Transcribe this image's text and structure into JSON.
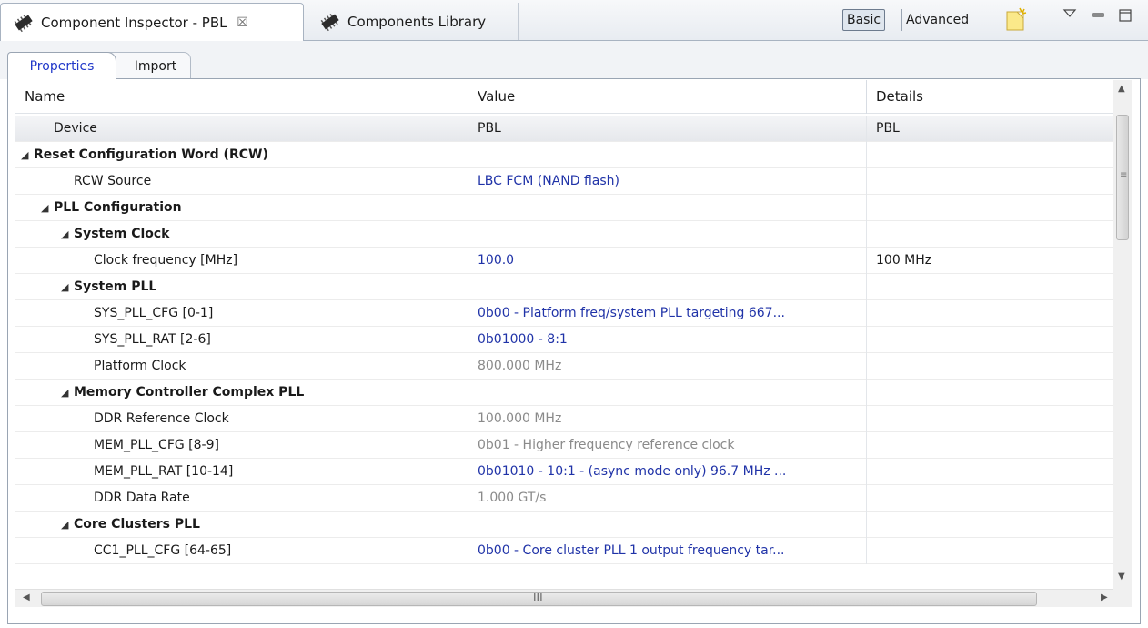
{
  "view_tabs": [
    {
      "label": "Component Inspector - PBL",
      "icon": "component-icon",
      "close": "☒"
    },
    {
      "label": "Components Library",
      "icon": "component-icon"
    }
  ],
  "toolbar": {
    "basic_label": "Basic",
    "advanced_label": "Advanced"
  },
  "sub_tabs": [
    "Properties",
    "Import"
  ],
  "table": {
    "columns": [
      "Name",
      "Value",
      "Details"
    ],
    "rows": [
      {
        "name": "Device",
        "value": "PBL",
        "details": "PBL",
        "indent": 1,
        "expander": false,
        "bold": false,
        "style": "normal"
      },
      {
        "name": "Reset Configuration Word (RCW)",
        "value": "",
        "details": "",
        "indent": 0,
        "expander": true,
        "bold": true,
        "style": "normal"
      },
      {
        "name": "RCW Source",
        "value": "LBC FCM (NAND flash)",
        "details": "",
        "indent": 2,
        "expander": false,
        "bold": false,
        "style": "blue"
      },
      {
        "name": "PLL Configuration",
        "value": "",
        "details": "",
        "indent": 1,
        "expander": true,
        "bold": true,
        "style": "normal"
      },
      {
        "name": "System Clock",
        "value": "",
        "details": "",
        "indent": 2,
        "expander": true,
        "bold": true,
        "style": "normal"
      },
      {
        "name": "Clock frequency [MHz]",
        "value": "100.0",
        "details": "100 MHz",
        "indent": 3,
        "expander": false,
        "bold": false,
        "style": "blue"
      },
      {
        "name": "System PLL",
        "value": "",
        "details": "",
        "indent": 2,
        "expander": true,
        "bold": true,
        "style": "normal"
      },
      {
        "name": "SYS_PLL_CFG  [0-1]",
        "value": "0b00 - Platform freq/system PLL targeting 667...",
        "details": "",
        "indent": 3,
        "expander": false,
        "bold": false,
        "style": "blue"
      },
      {
        "name": "SYS_PLL_RAT  [2-6]",
        "value": "0b01000 - 8:1",
        "details": "",
        "indent": 3,
        "expander": false,
        "bold": false,
        "style": "blue"
      },
      {
        "name": "Platform Clock",
        "value": "800.000 MHz",
        "details": "",
        "indent": 3,
        "expander": false,
        "bold": false,
        "style": "gray"
      },
      {
        "name": "Memory Controller Complex PLL",
        "value": "",
        "details": "",
        "indent": 2,
        "expander": true,
        "bold": true,
        "style": "normal"
      },
      {
        "name": "DDR Reference Clock",
        "value": "100.000 MHz",
        "details": "",
        "indent": 3,
        "expander": false,
        "bold": false,
        "style": "gray"
      },
      {
        "name": "MEM_PLL_CFG  [8-9]",
        "value": "0b01 - Higher frequency reference clock",
        "details": "",
        "indent": 3,
        "expander": false,
        "bold": false,
        "style": "gray"
      },
      {
        "name": "MEM_PLL_RAT  [10-14]",
        "value": "0b01010 - 10:1 - (async mode only) 96.7 MHz ...",
        "details": "",
        "indent": 3,
        "expander": false,
        "bold": false,
        "style": "blue"
      },
      {
        "name": "DDR Data Rate",
        "value": "1.000 GT/s",
        "details": "",
        "indent": 3,
        "expander": false,
        "bold": false,
        "style": "gray"
      },
      {
        "name": "Core Clusters PLL",
        "value": "",
        "details": "",
        "indent": 2,
        "expander": true,
        "bold": true,
        "style": "normal"
      },
      {
        "name": "CC1_PLL_CFG  [64-65]",
        "value": "0b00 - Core cluster PLL 1 output frequency tar...",
        "details": "",
        "indent": 3,
        "expander": false,
        "bold": false,
        "style": "blue"
      }
    ]
  },
  "scrollbar": {
    "grip": "III"
  },
  "colors": {
    "link_blue": "#2033a8",
    "tab_blue": "#2037c9",
    "muted": "#8a8a8a"
  },
  "icons": [
    "component-icon",
    "close-icon",
    "new-note-icon",
    "view-menu-icon",
    "minimize-icon",
    "maximize-icon",
    "expand-icon"
  ]
}
